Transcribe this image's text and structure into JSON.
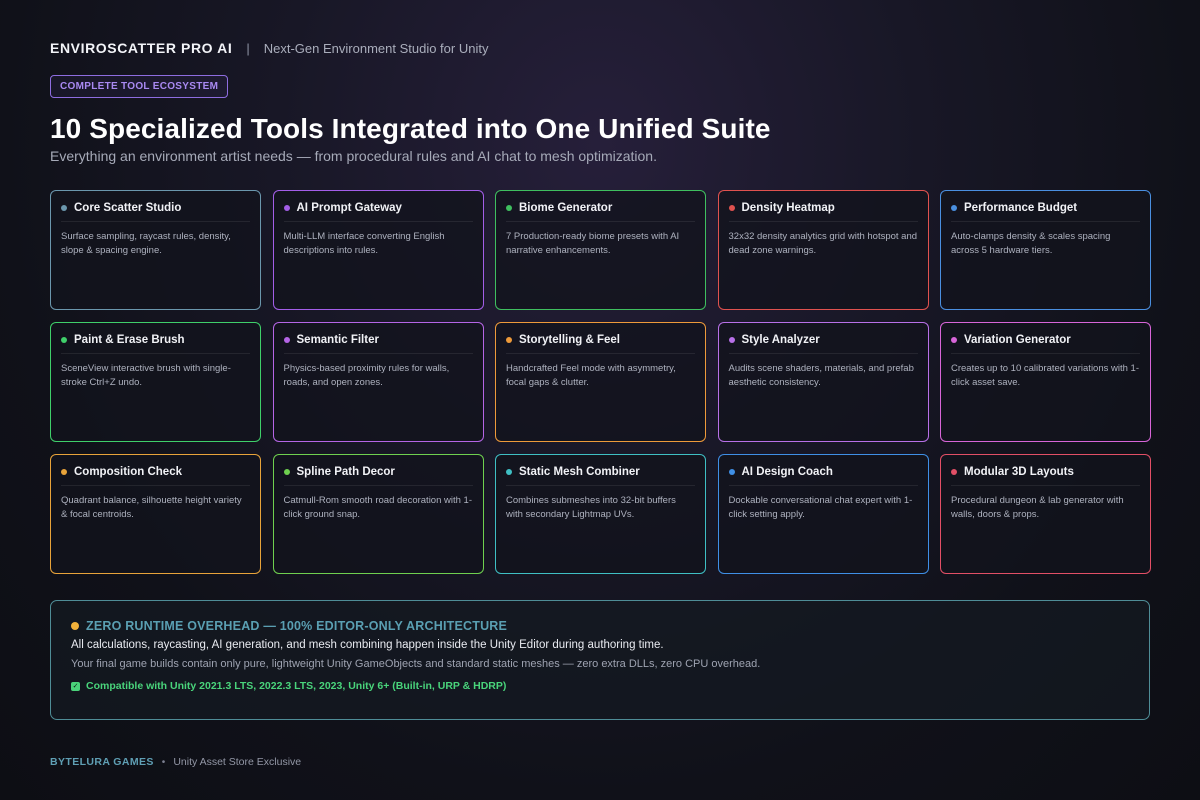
{
  "header": {
    "brand": "ENVIROSCATTER PRO AI",
    "separator": "|",
    "tagline": "Next-Gen Environment Studio for Unity"
  },
  "badge": {
    "label": "COMPLETE TOOL ECOSYSTEM"
  },
  "hero": {
    "title": "10 Specialized Tools Integrated into One Unified Suite",
    "subtitle": "Everything an environment artist needs — from procedural rules and AI chat to mesh optimization."
  },
  "tools": [
    {
      "title": "Core Scatter Studio",
      "desc": "Surface sampling, raycast rules, density, slope & spacing engine.",
      "color": "#6b97ad"
    },
    {
      "title": "AI Prompt Gateway",
      "desc": "Multi-LLM interface converting English descriptions into rules.",
      "color": "#a35ee8"
    },
    {
      "title": "Biome Generator",
      "desc": "7 Production-ready biome presets with AI narrative enhancements.",
      "color": "#3fbf5f"
    },
    {
      "title": "Density Heatmap",
      "desc": "32x32 density analytics grid with hotspot and dead zone warnings.",
      "color": "#e0524f"
    },
    {
      "title": "Performance Budget",
      "desc": "Auto-clamps density & scales spacing across 5 hardware tiers.",
      "color": "#4a8fe0"
    },
    {
      "title": "Paint & Erase Brush",
      "desc": "SceneView interactive brush with single-stroke Ctrl+Z undo.",
      "color": "#3fcf6a"
    },
    {
      "title": "Semantic Filter",
      "desc": "Physics-based proximity rules for walls, roads, and open zones.",
      "color": "#b565e6"
    },
    {
      "title": "Storytelling & Feel",
      "desc": "Handcrafted Feel mode with asymmetry, focal gaps & clutter.",
      "color": "#ee9a3a"
    },
    {
      "title": "Style Analyzer",
      "desc": "Audits scene shaders, materials, and prefab aesthetic consistency.",
      "color": "#b870e8"
    },
    {
      "title": "Variation Generator",
      "desc": "Creates up to 10 calibrated variations with 1-click asset save.",
      "color": "#d765d8"
    },
    {
      "title": "Composition Check",
      "desc": "Quadrant balance, silhouette height variety & focal centroids.",
      "color": "#e8a33a"
    },
    {
      "title": "Spline Path Decor",
      "desc": "Catmull-Rom smooth road decoration with 1-click ground snap.",
      "color": "#6fd04f"
    },
    {
      "title": "Static Mesh Combiner",
      "desc": "Combines submeshes into 32-bit buffers with secondary Lightmap UVs.",
      "color": "#3fbfc4"
    },
    {
      "title": "AI Design Coach",
      "desc": "Dockable conversational chat expert with 1-click setting apply.",
      "color": "#3f8fe6"
    },
    {
      "title": "Modular 3D Layouts",
      "desc": "Procedural dungeon & lab generator with walls, doors & props.",
      "color": "#e24f66"
    }
  ],
  "notice": {
    "title": "ZERO RUNTIME OVERHEAD — 100% EDITOR-ONLY ARCHITECTURE",
    "line1": "All calculations, raycasting, AI generation, and mesh combining happen inside the Unity Editor during authoring time.",
    "line2": "Your final game builds contain only pure, lightweight Unity GameObjects and standard static meshes — zero extra DLLs, zero CPU overhead.",
    "compat": "Compatible with Unity 2021.3 LTS, 2022.3 LTS, 2023, Unity 6+ (Built-in, URP & HDRP)",
    "check_glyph": "✓"
  },
  "footer": {
    "brand": "BYTELURA GAMES",
    "bullet": "•",
    "note": "Unity Asset Store Exclusive"
  }
}
